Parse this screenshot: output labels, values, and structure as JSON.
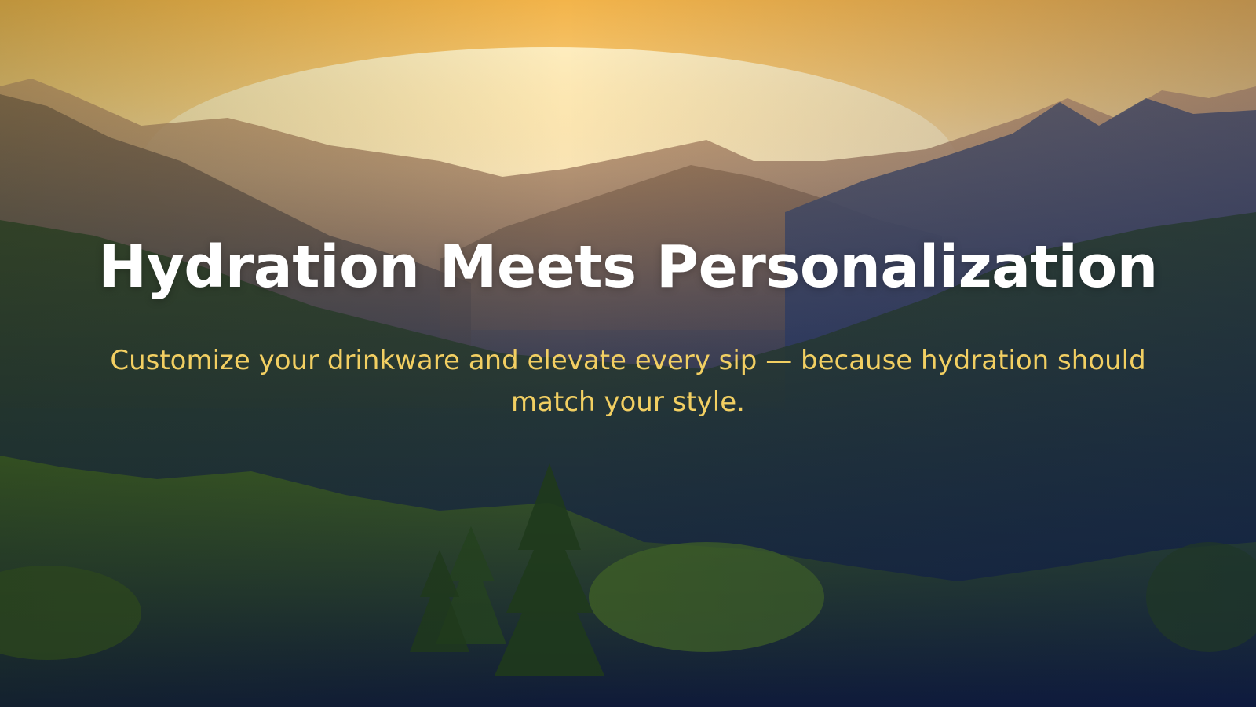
{
  "slide": {
    "title": "Hydration Meets Personalization",
    "subtitle": "Customize your drinkware and elevate every sip — because hydration should match your style.",
    "background_image": "mountain-sunset-forest-photo",
    "colors": {
      "title": "#ffffff",
      "subtitle": "#f2cf62",
      "sky": "#f6cc7c",
      "overlay": "#14295b"
    }
  }
}
